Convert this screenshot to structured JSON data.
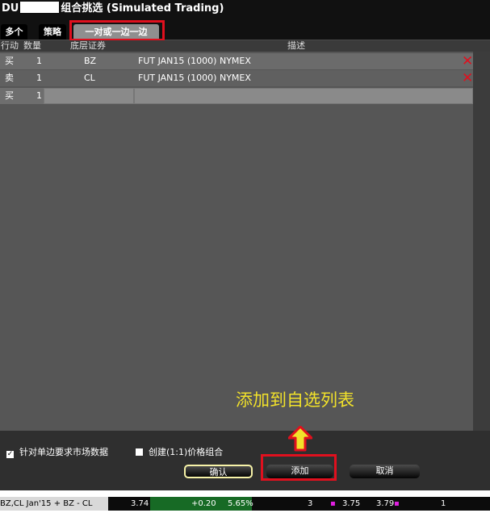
{
  "window": {
    "title_prefix": "DU",
    "title_suffix": "组合挑选 (Simulated Trading)"
  },
  "tabs": [
    {
      "label": "多个"
    },
    {
      "label": "策略"
    },
    {
      "label": "一对或一边一边"
    }
  ],
  "columns": {
    "action": "行动",
    "qty": "数量",
    "underlying": "底层证券",
    "desc": "描述"
  },
  "rows": [
    {
      "action": "买",
      "qty": "1",
      "underlying": "BZ",
      "desc": "FUT JAN15 (1000) NYMEX"
    },
    {
      "action": "卖",
      "qty": "1",
      "underlying": "CL",
      "desc": "FUT JAN15 (1000) NYMEX"
    },
    {
      "action": "买",
      "qty": "1",
      "underlying": "",
      "desc": ""
    }
  ],
  "annotation": "添加到自选列表",
  "options": {
    "market_data": {
      "label": "针对单边要求市场数据",
      "checked": true
    },
    "price_combo": {
      "label": "创建(1:1)价格组合",
      "checked": false
    }
  },
  "buttons": {
    "confirm": "确认",
    "add": "添加",
    "cancel": "取消"
  },
  "ticker": {
    "name": "BZ,CL Jan'15 + BZ - CL",
    "last": "3.74",
    "change": "+0.20",
    "change_pct": "5.65%",
    "bid_size": "3",
    "bid": "3.75",
    "ask": "3.79",
    "ask_size": "1"
  },
  "colors": {
    "highlight": "#e0101e",
    "annotation": "#f2e22a",
    "ticker_green": "#176a25"
  }
}
